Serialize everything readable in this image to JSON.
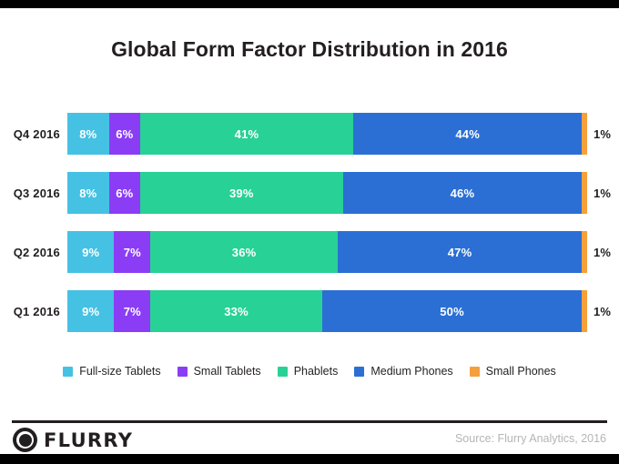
{
  "title": "Global Form Factor Distribution in 2016",
  "footer": {
    "brand_name": "FLURRY",
    "brand_mark": "flurry-circle-logo-icon",
    "source": "Source: Flurry Analytics, 2016"
  },
  "colors": {
    "full_size_tablets": "#45c1e3",
    "small_tablets": "#8b3df5",
    "phablets": "#28d196",
    "medium_phones": "#2b6fd4",
    "small_phones": "#f5a03c",
    "text_dark": "#231f20",
    "text_light": "#b5b5b5",
    "background": "#ffffff",
    "edge": "#000000"
  },
  "chart_data": {
    "type": "bar",
    "orientation": "horizontal",
    "stacked": true,
    "normalized": true,
    "title": "Global Form Factor Distribution in 2016",
    "xlabel": "",
    "ylabel": "",
    "xlim": [
      0,
      100
    ],
    "grid": false,
    "legend_position": "bottom",
    "value_suffix": "%",
    "categories": [
      "Q4 2016",
      "Q3 2016",
      "Q2 2016",
      "Q1 2016"
    ],
    "series": [
      {
        "name": "Full-size Tablets",
        "color": "#45c1e3",
        "values": [
          8,
          8,
          9,
          9
        ]
      },
      {
        "name": "Small Tablets",
        "color": "#8b3df5",
        "values": [
          6,
          6,
          7,
          7
        ]
      },
      {
        "name": "Phablets",
        "color": "#28d196",
        "values": [
          41,
          39,
          36,
          33
        ]
      },
      {
        "name": "Medium Phones",
        "color": "#2b6fd4",
        "values": [
          44,
          46,
          47,
          50
        ]
      },
      {
        "name": "Small Phones",
        "color": "#f5a03c",
        "values": [
          1,
          1,
          1,
          1
        ]
      }
    ],
    "rows": [
      {
        "category": "Q4 2016",
        "segments": [
          {
            "name": "Full-size Tablets",
            "value": 8,
            "label": "8%",
            "color": "#45c1e3",
            "label_inside": true
          },
          {
            "name": "Small Tablets",
            "value": 6,
            "label": "6%",
            "color": "#8b3df5",
            "label_inside": true
          },
          {
            "name": "Phablets",
            "value": 41,
            "label": "41%",
            "color": "#28d196",
            "label_inside": true
          },
          {
            "name": "Medium Phones",
            "value": 44,
            "label": "44%",
            "color": "#2b6fd4",
            "label_inside": true
          },
          {
            "name": "Small Phones",
            "value": 1,
            "label": "1%",
            "color": "#f5a03c",
            "label_inside": false
          }
        ],
        "outside_label": "1%"
      },
      {
        "category": "Q3 2016",
        "segments": [
          {
            "name": "Full-size Tablets",
            "value": 8,
            "label": "8%",
            "color": "#45c1e3",
            "label_inside": true
          },
          {
            "name": "Small Tablets",
            "value": 6,
            "label": "6%",
            "color": "#8b3df5",
            "label_inside": true
          },
          {
            "name": "Phablets",
            "value": 39,
            "label": "39%",
            "color": "#28d196",
            "label_inside": true
          },
          {
            "name": "Medium Phones",
            "value": 46,
            "label": "46%",
            "color": "#2b6fd4",
            "label_inside": true
          },
          {
            "name": "Small Phones",
            "value": 1,
            "label": "1%",
            "color": "#f5a03c",
            "label_inside": false
          }
        ],
        "outside_label": "1%"
      },
      {
        "category": "Q2 2016",
        "segments": [
          {
            "name": "Full-size Tablets",
            "value": 9,
            "label": "9%",
            "color": "#45c1e3",
            "label_inside": true
          },
          {
            "name": "Small Tablets",
            "value": 7,
            "label": "7%",
            "color": "#8b3df5",
            "label_inside": true
          },
          {
            "name": "Phablets",
            "value": 36,
            "label": "36%",
            "color": "#28d196",
            "label_inside": true
          },
          {
            "name": "Medium Phones",
            "value": 47,
            "label": "47%",
            "color": "#2b6fd4",
            "label_inside": true
          },
          {
            "name": "Small Phones",
            "value": 1,
            "label": "1%",
            "color": "#f5a03c",
            "label_inside": false
          }
        ],
        "outside_label": "1%"
      },
      {
        "category": "Q1 2016",
        "segments": [
          {
            "name": "Full-size Tablets",
            "value": 9,
            "label": "9%",
            "color": "#45c1e3",
            "label_inside": true
          },
          {
            "name": "Small Tablets",
            "value": 7,
            "label": "7%",
            "color": "#8b3df5",
            "label_inside": true
          },
          {
            "name": "Phablets",
            "value": 33,
            "label": "33%",
            "color": "#28d196",
            "label_inside": true
          },
          {
            "name": "Medium Phones",
            "value": 50,
            "label": "50%",
            "color": "#2b6fd4",
            "label_inside": true
          },
          {
            "name": "Small Phones",
            "value": 1,
            "label": "1%",
            "color": "#f5a03c",
            "label_inside": false
          }
        ],
        "outside_label": "1%"
      }
    ],
    "legend": [
      {
        "label": "Full-size Tablets",
        "color": "#45c1e3"
      },
      {
        "label": "Small Tablets",
        "color": "#8b3df5"
      },
      {
        "label": "Phablets",
        "color": "#28d196"
      },
      {
        "label": "Medium Phones",
        "color": "#2b6fd4"
      },
      {
        "label": "Small Phones",
        "color": "#f5a03c"
      }
    ]
  }
}
